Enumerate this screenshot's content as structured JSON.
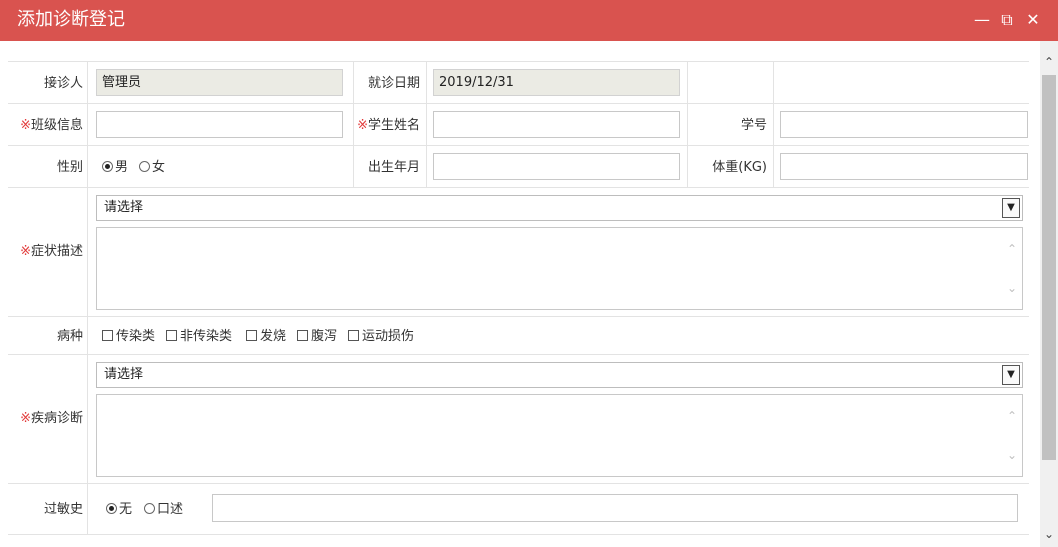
{
  "window": {
    "title": "添加诊断登记",
    "minimize_glyph": "—",
    "maximize_glyph": "⧉",
    "close_glyph": "✕"
  },
  "required_mark": "※",
  "form": {
    "doctor": {
      "label": "接诊人",
      "value": "管理员"
    },
    "visit_date": {
      "label": "就诊日期",
      "value": "2019/12/31"
    },
    "class_info": {
      "label": "班级信息",
      "value": ""
    },
    "student_name": {
      "label": "学生姓名",
      "value": ""
    },
    "student_id": {
      "label": "学号",
      "value": ""
    },
    "gender": {
      "label": "性别",
      "options": [
        "男",
        "女"
      ],
      "selected": "男"
    },
    "birth": {
      "label": "出生年月",
      "value": ""
    },
    "weight": {
      "label": "体重(KG)",
      "value": ""
    },
    "symptoms": {
      "label": "症状描述",
      "select_value": "请选择",
      "text": ""
    },
    "disease_type": {
      "label": "病种",
      "options": [
        "传染类",
        "非传染类",
        "发烧",
        "腹泻",
        "运动损伤"
      ]
    },
    "diagnosis": {
      "label": "疾病诊断",
      "select_value": "请选择",
      "text": ""
    },
    "allergy": {
      "label": "过敏史",
      "options": [
        "无",
        "口述"
      ],
      "selected": "无",
      "value": ""
    }
  },
  "icons": {
    "select_arrow": "chevron-down-icon",
    "scroll_up": "chevron-up-icon",
    "scroll_down": "chevron-down-icon"
  }
}
